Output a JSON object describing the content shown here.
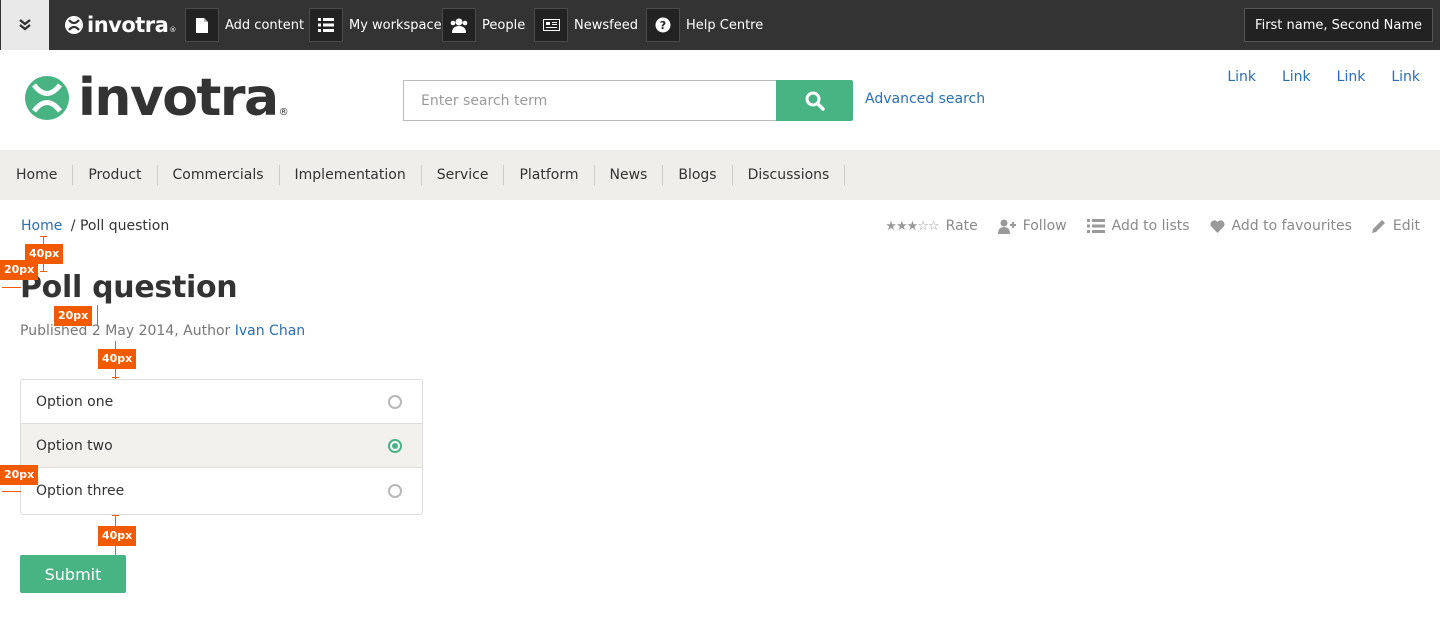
{
  "adminbar": {
    "logo_text": "invotra",
    "items": [
      {
        "label": "Add content",
        "icon": "document-icon"
      },
      {
        "label": "My workspace",
        "icon": "list-icon"
      },
      {
        "label": "People",
        "icon": "people-icon"
      },
      {
        "label": "Newsfeed",
        "icon": "newspaper-icon"
      },
      {
        "label": "Help Centre",
        "icon": "question-icon"
      }
    ],
    "user": "First name, Second Name"
  },
  "header": {
    "brand_text": "invotra",
    "search_placeholder": "Enter search term",
    "advanced_search": "Advanced search",
    "toplinks": [
      "Link",
      "Link",
      "Link",
      "Link"
    ]
  },
  "nav": {
    "items": [
      "Home",
      "Product",
      "Commercials",
      "Implementation",
      "Service",
      "Platform",
      "News",
      "Blogs",
      "Discussions"
    ]
  },
  "breadcrumb": {
    "home": "Home",
    "separator": "/",
    "current": "Poll question"
  },
  "actions": {
    "rating_stars": "★★★☆☆",
    "rate": "Rate",
    "follow": "Follow",
    "add_to_lists": "Add to lists",
    "add_to_favourites": "Add to favourites",
    "edit": "Edit"
  },
  "page": {
    "title": "Poll question",
    "meta_prefix": "Published 2 May 2014, Author",
    "author": "Ivan Chan"
  },
  "poll": {
    "options": [
      {
        "label": "Option one",
        "selected": false
      },
      {
        "label": "Option two",
        "selected": true
      },
      {
        "label": "Option three",
        "selected": false
      }
    ],
    "submit": "Submit"
  },
  "annotations": {
    "a1": "40px",
    "a2": "20px",
    "a3": "20px",
    "a4": "40px",
    "a5": "20px",
    "a6": "40px"
  },
  "colors": {
    "accent": "#48b484",
    "link": "#2a6fb2",
    "adminbar": "#333333",
    "annotation": "#f25a00"
  }
}
